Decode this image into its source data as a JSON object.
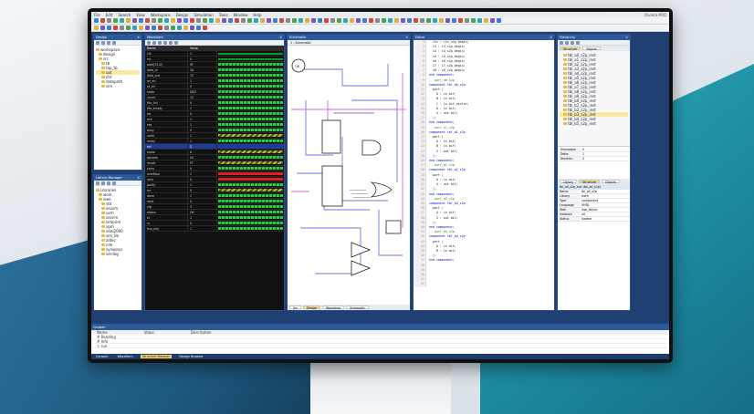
{
  "menu": {
    "items": [
      "File",
      "Edit",
      "Search",
      "View",
      "Workspace",
      "Design",
      "Simulation",
      "Tools",
      "Window",
      "Help"
    ],
    "title": "Riviera-PRO"
  },
  "panels": {
    "design_browser": {
      "title": "Design",
      "tree": [
        "workspace",
        "design",
        "src",
        "tb",
        "top_tb",
        "uut",
        "ctrl",
        "datapath",
        "sim"
      ]
    },
    "library": {
      "title": "Library Manager",
      "tree": [
        "Libraries",
        "work",
        "ieee",
        "std",
        "osvvm",
        "uvm",
        "unisim",
        "simprim",
        "xpm",
        "vital2000",
        "sim_lib",
        "aldec",
        "cdn",
        "synopsys",
        "verilog"
      ]
    },
    "waveform": {
      "title": "Waveform",
      "col_name": "Name",
      "col_value": "Value",
      "signals": [
        {
          "name": "clk",
          "value": "1",
          "kind": "flat"
        },
        {
          "name": "rst",
          "value": "0",
          "kind": "flat"
        },
        {
          "name": "addr[31:0]",
          "value": "0F",
          "kind": "bus"
        },
        {
          "name": "data_in",
          "value": "3A",
          "kind": "bus"
        },
        {
          "name": "data_out",
          "value": "7C",
          "kind": "bus"
        },
        {
          "name": "wr_en",
          "value": "1",
          "kind": "bus"
        },
        {
          "name": "rd_en",
          "value": "0",
          "kind": "bus"
        },
        {
          "name": "state",
          "value": "IDLE",
          "kind": "bus"
        },
        {
          "name": "count",
          "value": "12",
          "kind": "bus"
        },
        {
          "name": "fifo_full",
          "value": "0",
          "kind": "bus"
        },
        {
          "name": "fifo_empty",
          "value": "1",
          "kind": "bus"
        },
        {
          "name": "irq",
          "value": "0",
          "kind": "bus"
        },
        {
          "name": "ack",
          "value": "1",
          "kind": "bus"
        },
        {
          "name": "req",
          "value": "1",
          "kind": "bus"
        },
        {
          "name": "busy",
          "value": "0",
          "kind": "bus"
        },
        {
          "name": "valid",
          "value": "1",
          "kind": "yellow"
        },
        {
          "name": "ready",
          "value": "1",
          "kind": "bus"
        },
        {
          "name": "sel",
          "value": "2",
          "kind": "selected"
        },
        {
          "name": "mode",
          "value": "A",
          "kind": "yellow"
        },
        {
          "name": "opcode",
          "value": "04",
          "kind": "bus"
        },
        {
          "name": "result",
          "value": "FF",
          "kind": "yellow"
        },
        {
          "name": "carry",
          "value": "0",
          "kind": "bus"
        },
        {
          "name": "overflow",
          "value": "1",
          "kind": "red"
        },
        {
          "name": "zero",
          "value": "0",
          "kind": "red"
        },
        {
          "name": "parity",
          "value": "1",
          "kind": "bus"
        },
        {
          "name": "err",
          "value": "0",
          "kind": "yellow"
        },
        {
          "name": "done",
          "value": "1",
          "kind": "bus"
        },
        {
          "name": "start",
          "value": "0",
          "kind": "bus"
        },
        {
          "name": "cfg",
          "value": "3",
          "kind": "bus"
        },
        {
          "name": "status",
          "value": "OK",
          "kind": "bus"
        },
        {
          "name": "tx",
          "value": "1",
          "kind": "bus"
        },
        {
          "name": "rx",
          "value": "0",
          "kind": "bus"
        },
        {
          "name": "bus_req",
          "value": "1",
          "kind": "bus"
        }
      ]
    },
    "schematic": {
      "title": "Schematic",
      "tab": "1 - Schematic",
      "block_label": "OR",
      "footer_tabs": [
        "Src",
        "Design",
        "Waveform",
        "Schematic"
      ]
    },
    "code": {
      "title": "Editor",
      "lines": [
        {
          "n": "1",
          "t": "  i2c : i2c_s2p_begin;"
        },
        {
          "n": "2",
          "t": "  i3 : i3_s2p_begin;"
        },
        {
          "n": "3",
          "t": "  i4 : i4_s2p_begin;"
        },
        {
          "n": "4",
          "t": "  i5 : i5_s2p_begin;"
        },
        {
          "n": "5",
          "t": "  i6 : i6_s2p_begin;"
        },
        {
          "n": "6",
          "t": "  i7 : i7_s2p_begin;"
        },
        {
          "n": "7",
          "t": "  i8 : i8_s2p_begin;"
        },
        {
          "n": "8",
          "t": "end component;"
        },
        {
          "n": "9",
          "t": ""
        },
        {
          "n": "10",
          "t": "-- port_a0_s2p"
        },
        {
          "n": "11",
          "t": "component tbl_a0_s2p"
        },
        {
          "n": "12",
          "t": "  port ("
        },
        {
          "n": "13",
          "t": "    A : in bit;"
        },
        {
          "n": "14",
          "t": "    B : in bit;"
        },
        {
          "n": "15",
          "t": "    C : in bit_vector;"
        },
        {
          "n": "16",
          "t": "    D : in bit;"
        },
        {
          "n": "17",
          "t": "    X : out bit;"
        },
        {
          "n": "18",
          "t": "  );"
        },
        {
          "n": "19",
          "t": "end component;"
        },
        {
          "n": "20",
          "t": ""
        },
        {
          "n": "21",
          "t": "-- port_a1_s2p"
        },
        {
          "n": "22",
          "t": "component tbl_a1_s2p"
        },
        {
          "n": "23",
          "t": "  port ("
        },
        {
          "n": "24",
          "t": "    A : in bit;"
        },
        {
          "n": "25",
          "t": "    B : in bit;"
        },
        {
          "n": "26",
          "t": "    X : out bit;"
        },
        {
          "n": "27",
          "t": "  );"
        },
        {
          "n": "28",
          "t": "end component;"
        },
        {
          "n": "29",
          "t": ""
        },
        {
          "n": "30",
          "t": "-- port_a2_s2p"
        },
        {
          "n": "31",
          "t": "component tbl_a2_s2p"
        },
        {
          "n": "32",
          "t": "  port ("
        },
        {
          "n": "33",
          "t": "    A : in bit;"
        },
        {
          "n": "34",
          "t": "    X : out bit;"
        },
        {
          "n": "35",
          "t": "  );"
        },
        {
          "n": "36",
          "t": "end component;"
        },
        {
          "n": "37",
          "t": ""
        },
        {
          "n": "38",
          "t": "-- port_a3_s2p"
        },
        {
          "n": "39",
          "t": "component tbl_a3_s2p"
        },
        {
          "n": "40",
          "t": "  port ("
        },
        {
          "n": "41",
          "t": "    A : in bit;"
        },
        {
          "n": "42",
          "t": "    X : out bit;"
        },
        {
          "n": "43",
          "t": "  );"
        },
        {
          "n": "44",
          "t": "end component;"
        },
        {
          "n": "45",
          "t": ""
        },
        {
          "n": "46",
          "t": "-- port_a4_s2p"
        },
        {
          "n": "47",
          "t": "component tbl_a4_s2p"
        },
        {
          "n": "48",
          "t": "  port ("
        },
        {
          "n": "49",
          "t": "    A : in bit;"
        },
        {
          "n": "50",
          "t": "    B : in bit;"
        },
        {
          "n": "51",
          "t": "  );"
        },
        {
          "n": "52",
          "t": "end component;"
        }
      ]
    },
    "hierarchy": {
      "title": "Hierarchy",
      "tabs": [
        "Structure",
        "Objects"
      ],
      "items": [
        "tbl_a0_s2p_inst",
        "tbl_a1_s2p_inst",
        "tbl_a2_s2p_inst",
        "tbl_a3_s2p_inst",
        "tbl_a4_s2p_inst",
        "tbl_a5_s2p_inst",
        "tbl_a6_s2p_inst",
        "tbl_a7_s2p_inst",
        "tbl_a8_s2p_inst",
        "tbl_a9_s2p_inst",
        "tbl_b0_s2p_inst",
        "tbl_b1_s2p_inst",
        "tbl_b2_s2p_inst",
        "tbl_b3_s2p_inst",
        "tbl_b4_s2p_inst",
        "tbl_b5_s2p_inst"
      ],
      "mid_rows": [
        {
          "k": "Simulation time",
          "v": "0"
        },
        {
          "k": "Delta",
          "v": "1"
        },
        {
          "k": "Iteration",
          "v": "0"
        }
      ],
      "bottom_tabs": [
        "Library",
        "Structure",
        "Objects"
      ],
      "props_title": "tbl_a0_s2p_inst (tbl_a0_s2p)",
      "props": [
        {
          "k": "Name",
          "v": "tbl_a0_s2p"
        },
        {
          "k": "Library",
          "v": "work"
        },
        {
          "k": "Type",
          "v": "component"
        },
        {
          "k": "Language",
          "v": "VHDL"
        },
        {
          "k": "Path",
          "v": "/top_tb/uut"
        },
        {
          "k": "Instance",
          "v": "u0"
        },
        {
          "k": "Status",
          "v": "loaded"
        }
      ]
    }
  },
  "console": {
    "title": "Console",
    "header": [
      "Name",
      "Value",
      "Description"
    ],
    "rows": [
      {
        "name": "# Reading",
        "value": "",
        "desc": ""
      },
      {
        "name": "# Info",
        "value": "",
        "desc": ""
      },
      {
        "name": "> run",
        "value": "",
        "desc": ""
      }
    ]
  },
  "statusbar": {
    "items": [
      "Console",
      "Waveform",
      "Structure Browser",
      "Design Browser"
    ],
    "active": "Structure Browser"
  }
}
